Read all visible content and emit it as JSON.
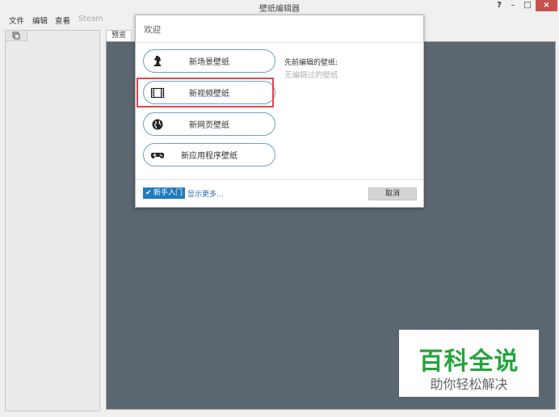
{
  "window": {
    "title": "壁纸编辑器",
    "help": "?",
    "minimize": "–",
    "maximize": "□",
    "close": "×"
  },
  "menu": {
    "file": "文件",
    "edit": "编辑",
    "view": "查看",
    "steam": "Steam"
  },
  "preview": {
    "tab_label": "预览"
  },
  "dialog": {
    "title": "欢迎",
    "options": [
      {
        "label": "新场景壁纸",
        "icon": "chess-knight-icon"
      },
      {
        "label": "新视频壁纸",
        "icon": "film-icon"
      },
      {
        "label": "新网页壁纸",
        "icon": "globe-icon"
      },
      {
        "label": "新应用程序壁纸",
        "icon": "gamepad-icon"
      }
    ],
    "recent_title": "先前编辑的壁纸:",
    "recent_empty": "无编辑过的壁纸",
    "newbie_label": "新手入门",
    "more_link": "显示更多...",
    "cancel_label": "取消"
  },
  "watermark": {
    "main": "百科全说",
    "sub": "助你轻松解决"
  },
  "colors": {
    "accent": "#1f7bbd",
    "preview_bg": "#5c6670",
    "highlight": "#e0464c",
    "watermark_green": "#25a43f"
  }
}
